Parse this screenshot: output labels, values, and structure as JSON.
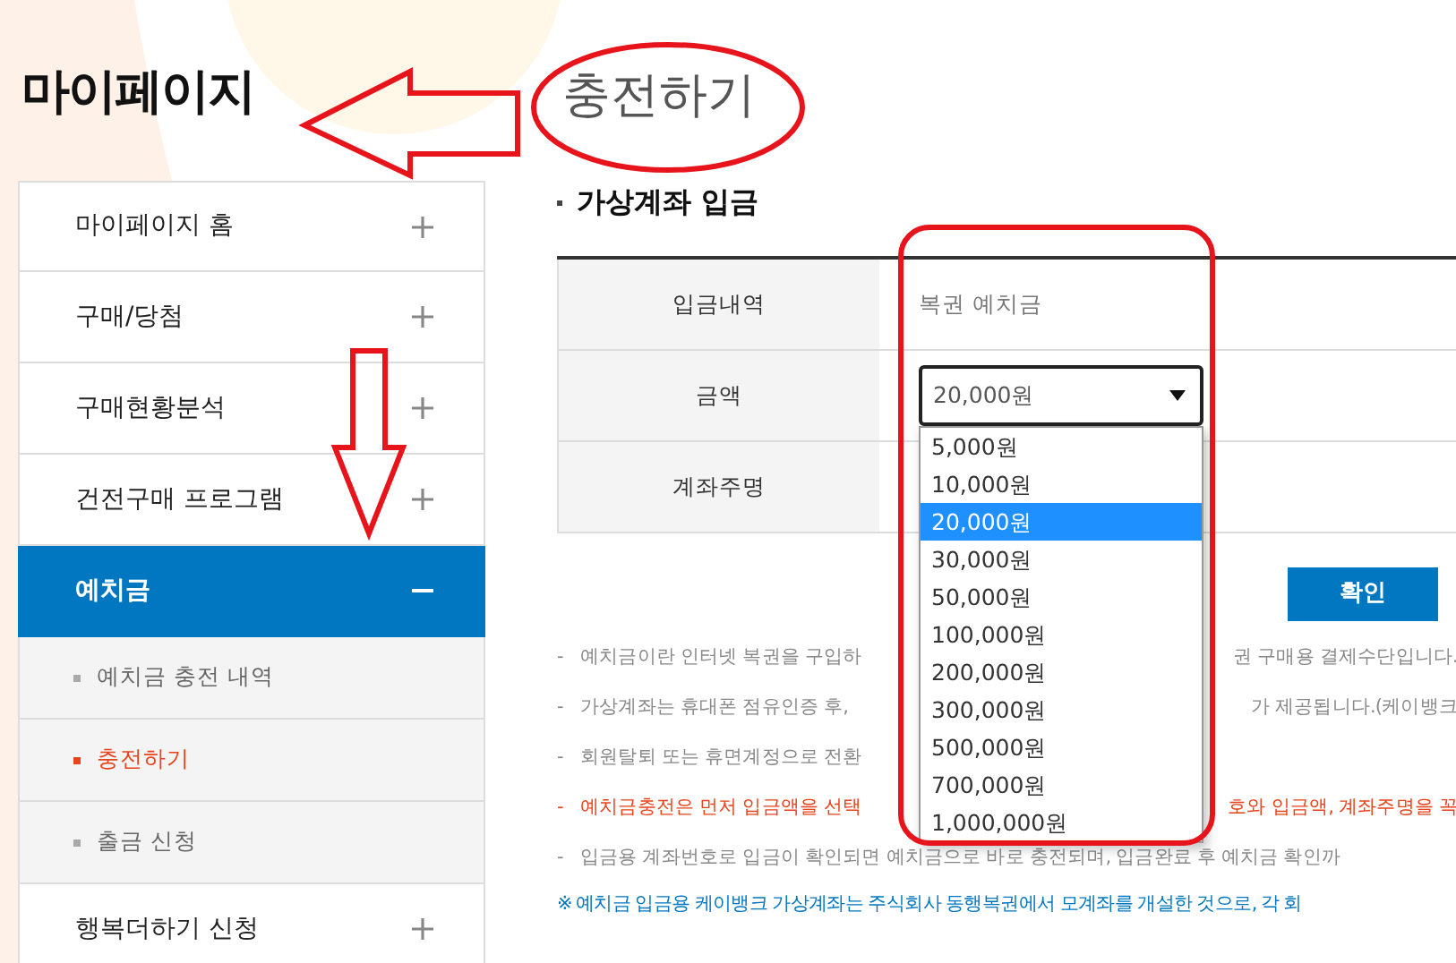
{
  "sidebar": {
    "title": "마이페이지",
    "items": [
      {
        "label": "마이페이지 홈",
        "expanded": false
      },
      {
        "label": "구매/당첨",
        "expanded": false
      },
      {
        "label": "구매현황분석",
        "expanded": false
      },
      {
        "label": "건전구매 프로그램",
        "expanded": false
      },
      {
        "label": "예치금",
        "expanded": true,
        "children": [
          {
            "label": "예치금 충전 내역",
            "selected": false
          },
          {
            "label": "충전하기",
            "selected": true
          },
          {
            "label": "출금 신청",
            "selected": false
          }
        ]
      },
      {
        "label": "행복더하기 신청",
        "expanded": false
      }
    ]
  },
  "page_title": "충전하기",
  "section_title": "가상계좌 입금",
  "form": {
    "rows": [
      {
        "kind": "text",
        "label": "입금내역",
        "value": "복권 예치금"
      },
      {
        "kind": "select",
        "label": "금액",
        "value": "20,000원",
        "open": true,
        "options": [
          {
            "label": "5,000원",
            "selected": false
          },
          {
            "label": "10,000원",
            "selected": false
          },
          {
            "label": "20,000원",
            "selected": true
          },
          {
            "label": "30,000원",
            "selected": false
          },
          {
            "label": "50,000원",
            "selected": false
          },
          {
            "label": "100,000원",
            "selected": false
          },
          {
            "label": "200,000원",
            "selected": false
          },
          {
            "label": "300,000원",
            "selected": false
          },
          {
            "label": "500,000원",
            "selected": false
          },
          {
            "label": "700,000원",
            "selected": false
          },
          {
            "label": "1,000,000원",
            "selected": false
          }
        ]
      },
      {
        "kind": "blank",
        "label": "계좌주명"
      }
    ]
  },
  "confirm_button": "확인",
  "notes": [
    {
      "kind": "plain",
      "bullet": "-",
      "left": "예치금이란 인터넷 복권을 구입하",
      "right": "권 구매용 결제수단입니다."
    },
    {
      "kind": "plain",
      "bullet": "-",
      "left": "가상계좌는 휴대폰 점유인증 후,",
      "right": "가 제공됩니다.(케이뱅크"
    },
    {
      "kind": "plain",
      "bullet": "-",
      "left": "회원탈퇴 또는 휴면계정으로 전환"
    },
    {
      "kind": "warning",
      "bullet": "-",
      "left": "예치금충전은 먼저 입금액을 선택",
      "right": "호와 입금액, 계좌주명을 꼭"
    },
    {
      "kind": "plain",
      "bullet": "-",
      "left": "입금용 계좌번호로 입금이 확인되면 예치금으로 바로 충전되며, 입금완료 후 예치금 확인까"
    }
  ],
  "footnote": "※ 예치금 입금용 케이뱅크 가상계좌는 주식회사 동행복권에서 모계좌를 개설한 것으로, 각 회"
}
